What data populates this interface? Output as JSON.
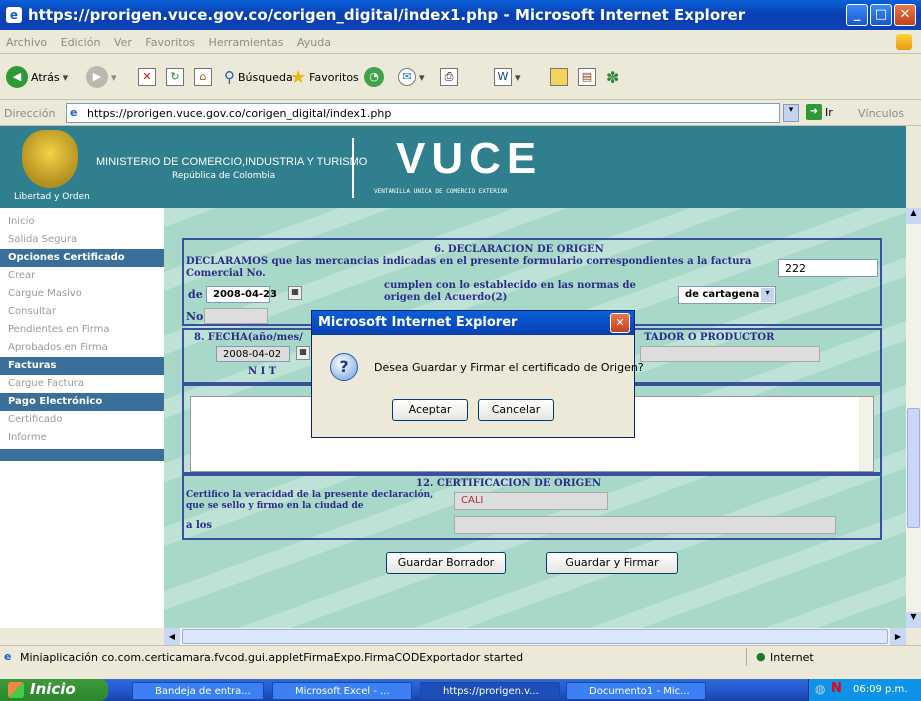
{
  "window": {
    "title": "https://prorigen.vuce.gov.co/corigen_digital/index1.php - Microsoft Internet Explorer"
  },
  "menu": [
    "Archivo",
    "Edición",
    "Ver",
    "Favoritos",
    "Herramientas",
    "Ayuda"
  ],
  "toolbar": {
    "back_label": "Atrás",
    "search_label": "Búsqueda",
    "favorites_label": "Favoritos"
  },
  "address": {
    "label": "Dirección",
    "url": "https://prorigen.vuce.gov.co/corigen_digital/index1.php",
    "go_label": "Ir",
    "links_label": "Vínculos"
  },
  "banner": {
    "ministry": "MINISTERIO DE COMERCIO,INDUSTRIA Y TURISMO",
    "country": "República de Colombia",
    "motto": "Libertad y Orden",
    "logo": "VUCE",
    "logo_sub": "VENTANILLA UNICA DE COMERCIO EXTERIOR"
  },
  "sidebar": [
    {
      "label": "Inicio",
      "section": false
    },
    {
      "label": "Salida Segura",
      "section": false
    },
    {
      "label": "Opciones Certificado",
      "section": true
    },
    {
      "label": "Crear",
      "section": false
    },
    {
      "label": "Cargue Masivo",
      "section": false
    },
    {
      "label": "Consultar",
      "section": false
    },
    {
      "label": "Pendientes en Firma",
      "section": false
    },
    {
      "label": "Aprobados en Firma",
      "section": false
    },
    {
      "label": "Facturas",
      "section": true
    },
    {
      "label": "Cargue Factura",
      "section": false
    },
    {
      "label": "Pago Electrónico",
      "section": true
    },
    {
      "label": "Certificado",
      "section": false
    },
    {
      "label": "Informe",
      "section": false
    }
  ],
  "form": {
    "decl_title": "6. DECLARACION DE ORIGEN",
    "decl_text": "DECLARAMOS que las mercancias indicadas en el presente formulario correspondientes a la factura Comercial No.",
    "invoice_no": "222",
    "de_label": "de",
    "de_date": "2008-04-23",
    "cumplen_text": "cumplen con lo establecido en las normas de origen del Acuerdo(2)",
    "acuerdo_value": "de cartagena",
    "no_label": "No.",
    "fecha_label": "8. FECHA(año/mes/",
    "fecha_value": "2008-04-02",
    "exportador_label": "TADOR O PRODUCTOR",
    "nit_label": "N I T",
    "cert_title": "12. CERTIFICACION DE ORIGEN",
    "cert_text": "Certifico la veracidad de la presente declaración, que se sello y firmo en la ciudad de",
    "city_value": "CALI",
    "a_los_label": "a los",
    "save_draft": "Guardar Borrador",
    "save_sign": "Guardar y Firmar"
  },
  "dialog": {
    "title": "Microsoft Internet Explorer",
    "message": "Desea Guardar y Firmar el certificado de Origen?",
    "ok": "Aceptar",
    "cancel": "Cancelar"
  },
  "status": {
    "text": "Miniaplicación co.com.certicamara.fvcod.gui.appletFirmaExpo.FirmaCODExportador started",
    "zone": "Internet"
  },
  "taskbar": {
    "start": "Inicio",
    "tasks": [
      "Bandeja de entra...",
      "Microsoft Excel - ...",
      "https://prorigen.v...",
      "Documento1 - Mic..."
    ],
    "clock": "06:09 p.m."
  }
}
